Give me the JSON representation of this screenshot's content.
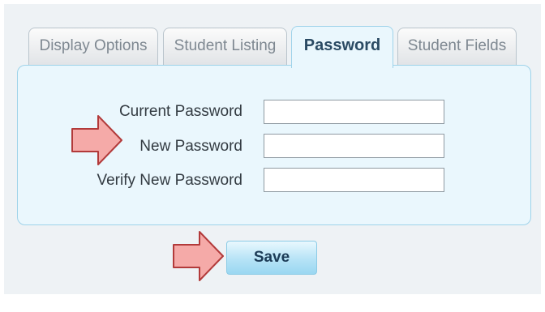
{
  "tabs": [
    {
      "label": "Display Options",
      "active": false
    },
    {
      "label": "Student Listing",
      "active": false
    },
    {
      "label": "Password",
      "active": true
    },
    {
      "label": "Student Fields",
      "active": false
    }
  ],
  "form": {
    "current_password_label": "Current Password",
    "current_password_value": "",
    "new_password_label": "New Password",
    "new_password_value": "",
    "verify_password_label": "Verify New Password",
    "verify_password_value": ""
  },
  "actions": {
    "save_label": "Save"
  },
  "colors": {
    "panel_background": "#eaf7fd",
    "panel_border": "#9fd3ea",
    "arrow_fill": "#f5aaa8",
    "arrow_stroke": "#b23a3a"
  },
  "annotations": {
    "arrow_icon": "right-arrow-icon"
  }
}
